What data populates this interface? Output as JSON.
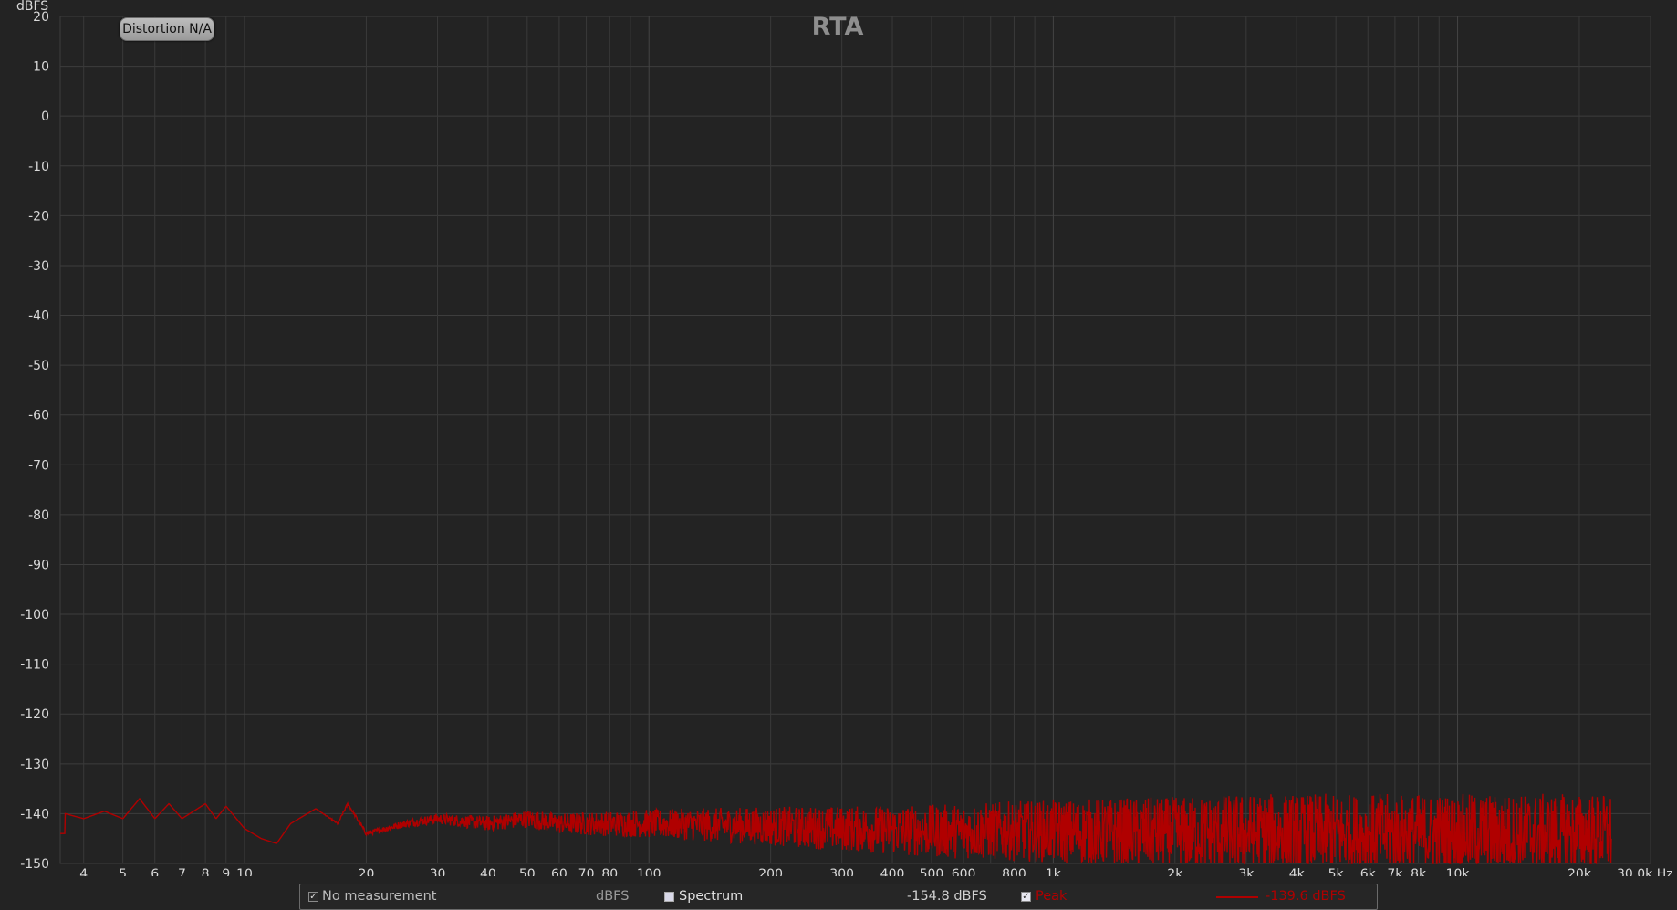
{
  "chart_data": {
    "type": "line",
    "title": "RTA",
    "ylabel": "dBFS",
    "xlabel": "Hz",
    "x_scale": "log",
    "xlim": [
      3.5,
      30000
    ],
    "ylim": [
      -150,
      20
    ],
    "y_ticks": [
      20,
      10,
      0,
      -10,
      -20,
      -30,
      -40,
      -50,
      -60,
      -70,
      -80,
      -90,
      -100,
      -110,
      -120,
      -130,
      -140,
      -150
    ],
    "x_ticks": [
      {
        "v": 4,
        "label": "4"
      },
      {
        "v": 5,
        "label": "5"
      },
      {
        "v": 6,
        "label": "6"
      },
      {
        "v": 7,
        "label": "7"
      },
      {
        "v": 8,
        "label": "8"
      },
      {
        "v": 9,
        "label": "9"
      },
      {
        "v": 10,
        "label": "10"
      },
      {
        "v": 20,
        "label": "20"
      },
      {
        "v": 30,
        "label": "30"
      },
      {
        "v": 40,
        "label": "40"
      },
      {
        "v": 50,
        "label": "50"
      },
      {
        "v": 60,
        "label": "60"
      },
      {
        "v": 70,
        "label": "70"
      },
      {
        "v": 80,
        "label": "80"
      },
      {
        "v": 100,
        "label": "100"
      },
      {
        "v": 200,
        "label": "200"
      },
      {
        "v": 300,
        "label": "300"
      },
      {
        "v": 400,
        "label": "400"
      },
      {
        "v": 500,
        "label": "500"
      },
      {
        "v": 600,
        "label": "600"
      },
      {
        "v": 800,
        "label": "800"
      },
      {
        "v": 1000,
        "label": "1k"
      },
      {
        "v": 2000,
        "label": "2k"
      },
      {
        "v": 3000,
        "label": "3k"
      },
      {
        "v": 4000,
        "label": "4k"
      },
      {
        "v": 5000,
        "label": "5k"
      },
      {
        "v": 6000,
        "label": "6k"
      },
      {
        "v": 7000,
        "label": "7k"
      },
      {
        "v": 8000,
        "label": "8k"
      },
      {
        "v": 10000,
        "label": "10k"
      },
      {
        "v": 20000,
        "label": "20k"
      }
    ],
    "x_end_label": "30.0k Hz",
    "grid": true,
    "series": [
      {
        "name": "Peak",
        "color": "#b00000",
        "x_range": [
          3.5,
          24000
        ],
        "points": [
          [
            3.6,
            -140
          ],
          [
            4,
            -141
          ],
          [
            4.5,
            -139.5
          ],
          [
            5,
            -141
          ],
          [
            5.5,
            -137
          ],
          [
            6,
            -141
          ],
          [
            6.5,
            -138
          ],
          [
            7,
            -141
          ],
          [
            8,
            -138
          ],
          [
            8.5,
            -141
          ],
          [
            9,
            -138.5
          ],
          [
            10,
            -143
          ],
          [
            11,
            -145
          ],
          [
            12,
            -146
          ],
          [
            13,
            -142
          ],
          [
            15,
            -139
          ],
          [
            17,
            -142
          ],
          [
            18,
            -138
          ],
          [
            20,
            -144
          ],
          [
            25,
            -142
          ],
          [
            30,
            -141
          ],
          [
            40,
            -142
          ],
          [
            50,
            -141
          ],
          [
            60,
            -142
          ],
          [
            80,
            -142
          ],
          [
            100,
            -142
          ],
          [
            200,
            -142.5
          ],
          [
            300,
            -143
          ],
          [
            500,
            -143.5
          ],
          [
            1000,
            -143.5
          ],
          [
            2000,
            -144
          ],
          [
            5000,
            -144
          ],
          [
            10000,
            -144
          ],
          [
            20000,
            -144
          ],
          [
            24000,
            -144
          ]
        ],
        "noise_band_db": 8,
        "peak_max": -135
      }
    ]
  },
  "distortion_button": "Distortion N/A",
  "legend": {
    "no_measurement": "No measurement",
    "unit": "dBFS",
    "spectrum": "Spectrum",
    "spectrum_value": "-154.8 dBFS",
    "peak": "Peak",
    "peak_value": "-139.6 dBFS",
    "peak_color": "#b00000"
  }
}
